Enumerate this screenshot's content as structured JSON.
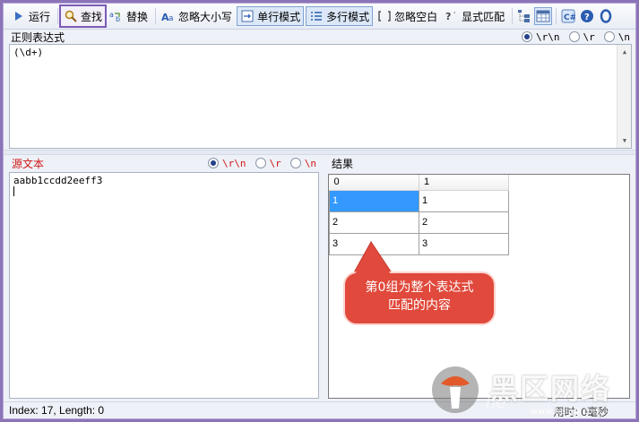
{
  "toolbar": {
    "run": "运行",
    "find": "查找",
    "replace": "替换",
    "ignore_case": "忽略大小写",
    "single_line": "单行模式",
    "multi_line": "多行模式",
    "ignore_whitespace": "忽略空白",
    "explicit_match": "显式匹配"
  },
  "regex": {
    "label": "正则表达式",
    "value": "(\\d+)",
    "newline_options": [
      "\\r\\n",
      "\\r",
      "\\n"
    ],
    "newline_selected": 0
  },
  "source": {
    "label": "源文本",
    "value": "aabb1ccdd2eeff3",
    "newline_options": [
      "\\r\\n",
      "\\r",
      "\\n"
    ],
    "newline_selected": 0
  },
  "results": {
    "label": "结果",
    "columns": [
      "0",
      "1"
    ],
    "rows": [
      [
        "1",
        "1"
      ],
      [
        "2",
        "2"
      ],
      [
        "3",
        "3"
      ]
    ],
    "selected_cell": [
      0,
      0
    ]
  },
  "callout": {
    "line1": "第0组为整个表达式",
    "line2": "匹配的内容"
  },
  "status": {
    "text": "Index: 17, Length: 0",
    "right": "用时: 0毫秒"
  },
  "watermark": {
    "text": "黑区网络",
    "he": "he",
    "url": "www.heiqu.com"
  },
  "colors": {
    "accent_outline": "#7b5bb7",
    "selected_cell": "#3399ff",
    "callout_fill": "#e0493c",
    "label_red": "#d01818"
  }
}
